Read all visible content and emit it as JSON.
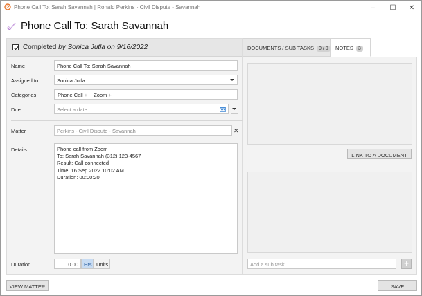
{
  "window": {
    "title": "Phone Call To: Sarah Savannah | Ronald Perkins - Civil Dispute - Savannah",
    "minimize": "–",
    "maximize": "☐",
    "close": "✕"
  },
  "header": {
    "title": "Phone Call To: Sarah Savannah"
  },
  "completed": {
    "prefix": "Completed",
    "by_text": "by Sonica Jutla on 9/16/2022",
    "checked": true
  },
  "form": {
    "name_label": "Name",
    "name_value": "Phone Call To: Sarah Savannah",
    "assigned_label": "Assigned to",
    "assigned_value": "Sonica Jutla",
    "categories_label": "Categories",
    "categories": [
      "Phone Call",
      "Zoom"
    ],
    "due_label": "Due",
    "due_placeholder": "Select a date",
    "matter_label": "Matter",
    "matter_value": "Perkins - Civil Dispute - Savannah",
    "matter_clear": "✕",
    "details_label": "Details",
    "details_lines": [
      "Phone call from Zoom",
      "To: Sarah Savannah (312) 123-4567",
      "Result: Call connected",
      "Time: 16 Sep 2022 10:02 AM",
      "Duration: 00:00:20"
    ],
    "duration_label": "Duration",
    "duration_value": "0.00",
    "unit_hrs": "Hrs",
    "unit_units": "Units"
  },
  "tabs": {
    "docs_label": "DOCUMENTS / SUB TASKS",
    "docs_count": "0 / 0",
    "notes_label": "NOTES",
    "notes_count": "3"
  },
  "right": {
    "link_button": "LINK TO A DOCUMENT",
    "subtask_placeholder": "Add a sub task",
    "add_symbol": "+"
  },
  "footer": {
    "view_matter": "VIEW MATTER",
    "save": "SAVE"
  },
  "colors": {
    "app_icon": "#e8772e",
    "header_icon": "#b67fd3",
    "active_unit_bg": "#c8dcf3"
  }
}
